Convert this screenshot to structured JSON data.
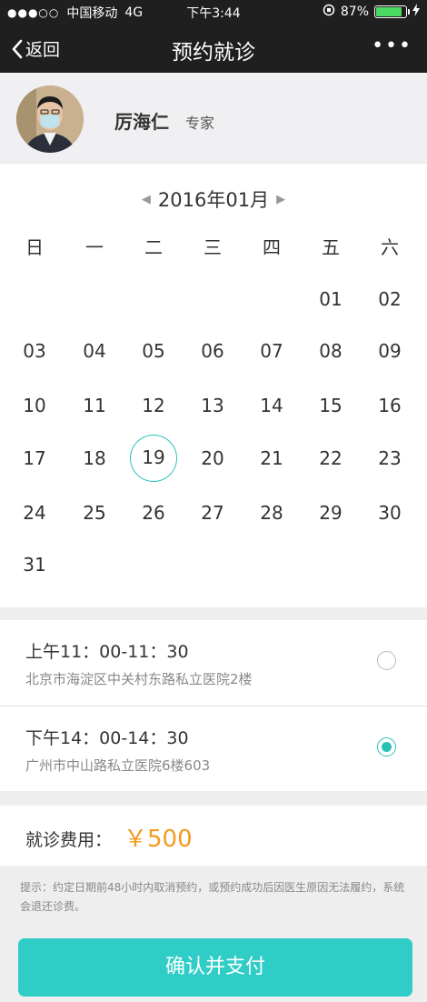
{
  "status_bar": {
    "signal": "●●●○○",
    "carrier": "中国移动",
    "network": "4G",
    "time": "下午3:44",
    "battery_percent": "87%",
    "battery_level": 0.87
  },
  "nav": {
    "back_label": "返回",
    "title": "预约就诊",
    "more_label": "•••"
  },
  "doctor": {
    "name": "厉海仁",
    "title_tag": "专家"
  },
  "calendar": {
    "month_label": "2016年01月",
    "prev_icon": "◀",
    "next_icon": "▶",
    "weekdays": [
      "日",
      "一",
      "二",
      "三",
      "四",
      "五",
      "六"
    ],
    "first_weekday_index": 5,
    "days": [
      "01",
      "02",
      "03",
      "04",
      "05",
      "06",
      "07",
      "08",
      "09",
      "10",
      "11",
      "12",
      "13",
      "14",
      "15",
      "16",
      "17",
      "18",
      "19",
      "20",
      "21",
      "22",
      "23",
      "24",
      "25",
      "26",
      "27",
      "28",
      "29",
      "30",
      "31"
    ],
    "selected_day": "19",
    "accent_color": "#2cc1b8"
  },
  "slots": [
    {
      "time": "上午11：00-11：30",
      "address": "北京市海淀区中关村东路私立医院2楼",
      "checked": false
    },
    {
      "time": "下午14：00-14：30",
      "address": "广州市中山路私立医院6楼603",
      "checked": true
    }
  ],
  "fee": {
    "label": "就诊费用：",
    "amount": "￥500",
    "amount_color": "#f39a1f"
  },
  "notice": "提示：约定日期前48小时内取消预约，或预约成功后因医生原因无法履约，系统会退还诊费。",
  "confirm_button": {
    "label": "确认并支付",
    "color": "#30cdc6"
  }
}
